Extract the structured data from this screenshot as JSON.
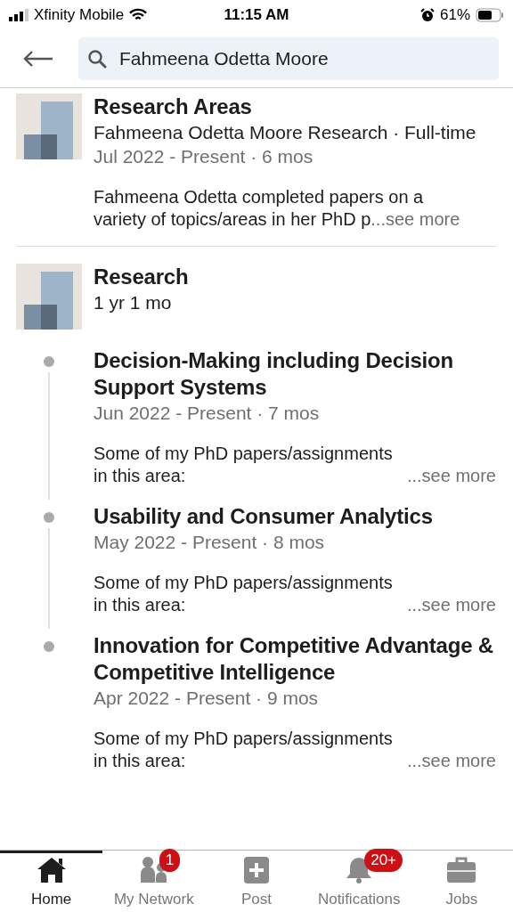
{
  "status_bar": {
    "carrier": "Xfinity Mobile",
    "time": "11:15 AM",
    "battery": "61%"
  },
  "search": {
    "value": "Fahmeena Odetta Moore"
  },
  "experiences": [
    {
      "title": "Research Areas",
      "subtitle": "Fahmeena Odetta Moore Research · Full-time",
      "dates": "Jul 2022 - Present · 6 mos",
      "description": "Fahmeena Odetta completed papers on a variety of topics/areas in her PhD p",
      "see_more": "...see more"
    }
  ],
  "group": {
    "title": "Research",
    "duration": "1 yr 1 mo",
    "positions": [
      {
        "title": "Decision-Making including Decision Support Systems",
        "dates": "Jun 2022 - Present · 7 mos",
        "description": "Some of my PhD papers/assignments in this area:",
        "see_more": "...see more"
      },
      {
        "title": "Usability and Consumer Analytics",
        "dates": "May 2022 - Present · 8 mos",
        "description": "Some of my PhD papers/assignments in this area:",
        "see_more": "...see more"
      },
      {
        "title": "Innovation for Competitive Advantage & Competitive Intelligence",
        "dates": "Apr 2022 - Present · 9 mos",
        "description": "Some of my PhD papers/assignments in this area:",
        "see_more": "...see more"
      }
    ]
  },
  "nav": [
    {
      "label": "Home",
      "selected": true
    },
    {
      "label": "My Network",
      "selected": false,
      "badge": "1"
    },
    {
      "label": "Post",
      "selected": false
    },
    {
      "label": "Notifications",
      "selected": false,
      "badge": "20+"
    },
    {
      "label": "Jobs",
      "selected": false
    }
  ]
}
